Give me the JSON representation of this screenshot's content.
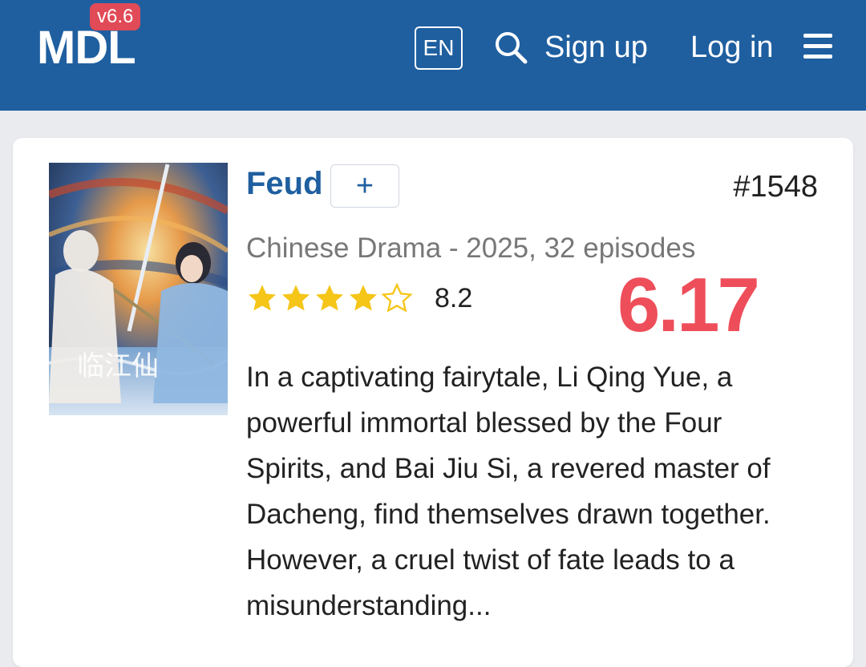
{
  "header": {
    "logo": "MDL",
    "version": "v6.6",
    "language": "EN",
    "signup_label": "Sign up",
    "login_label": "Log in",
    "search_icon": "search-icon",
    "menu_icon": "hamburger-menu-icon",
    "brand_color": "#1f5fa0"
  },
  "drama": {
    "title": "Feud",
    "add_button_label": "+",
    "rank": "#1548",
    "meta": "Chinese Drama - 2025, 32 episodes",
    "stars_filled": 4,
    "stars_total": 5,
    "rating": "8.2",
    "overlay_score": "6.17",
    "overlay_color": "#ee4e5a",
    "synopsis": "In a captivating fairytale, Li Qing Yue, a\npowerful immortal blessed by the Four\nSpirits, and Bai Jiu Si, a revered master of\nDacheng, find themselves drawn together.\nHowever, a cruel twist of fate leads to a\nmisunderstanding...",
    "poster_calligraphy": "临江仙"
  }
}
